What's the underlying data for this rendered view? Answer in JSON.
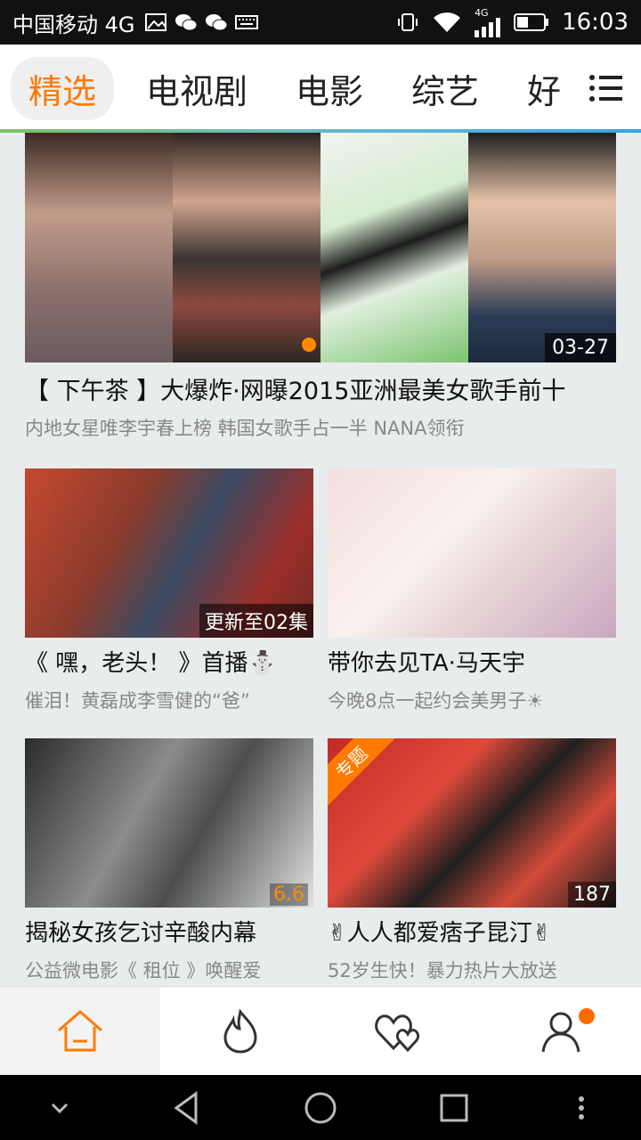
{
  "status_bar": {
    "carrier": "中国移动 4G",
    "network_label": "4G",
    "time": "16:03"
  },
  "tabs": {
    "items": [
      {
        "label": "精选",
        "active": true
      },
      {
        "label": "电视剧"
      },
      {
        "label": "电影"
      },
      {
        "label": "综艺"
      },
      {
        "label": "好"
      }
    ]
  },
  "hero": {
    "date_badge": "03-27",
    "title": "【 下午茶 】大爆炸·网曝2015亚洲最美女歌手前十",
    "subtitle": "内地女星唯李宇春上榜 韩国女歌手占一半 NANA领衔"
  },
  "cards": [
    {
      "badge": "更新至02集",
      "title": "《 嘿，老头！ 》首播⛄",
      "subtitle": "催泪！黄磊成李雪健的“爸”"
    },
    {
      "title": "带你去见TA·马天宇",
      "subtitle": "今晚8点一起约会美男子☀"
    },
    {
      "score": "6.6",
      "title": "揭秘女孩乞讨辛酸内幕",
      "subtitle": "公益微电影《 租位 》唤醒爱"
    },
    {
      "ribbon": "专题",
      "count": "187",
      "title": "✌人人都爱痞子昆汀✌",
      "subtitle": "52岁生快！暴力热片大放送"
    }
  ],
  "bottom_nav": {
    "items": [
      "home-icon",
      "hot-icon",
      "favorites-icon",
      "profile-icon"
    ]
  },
  "colors": {
    "accent": "#ff7a00",
    "tab_underline": "#33a6e6"
  }
}
